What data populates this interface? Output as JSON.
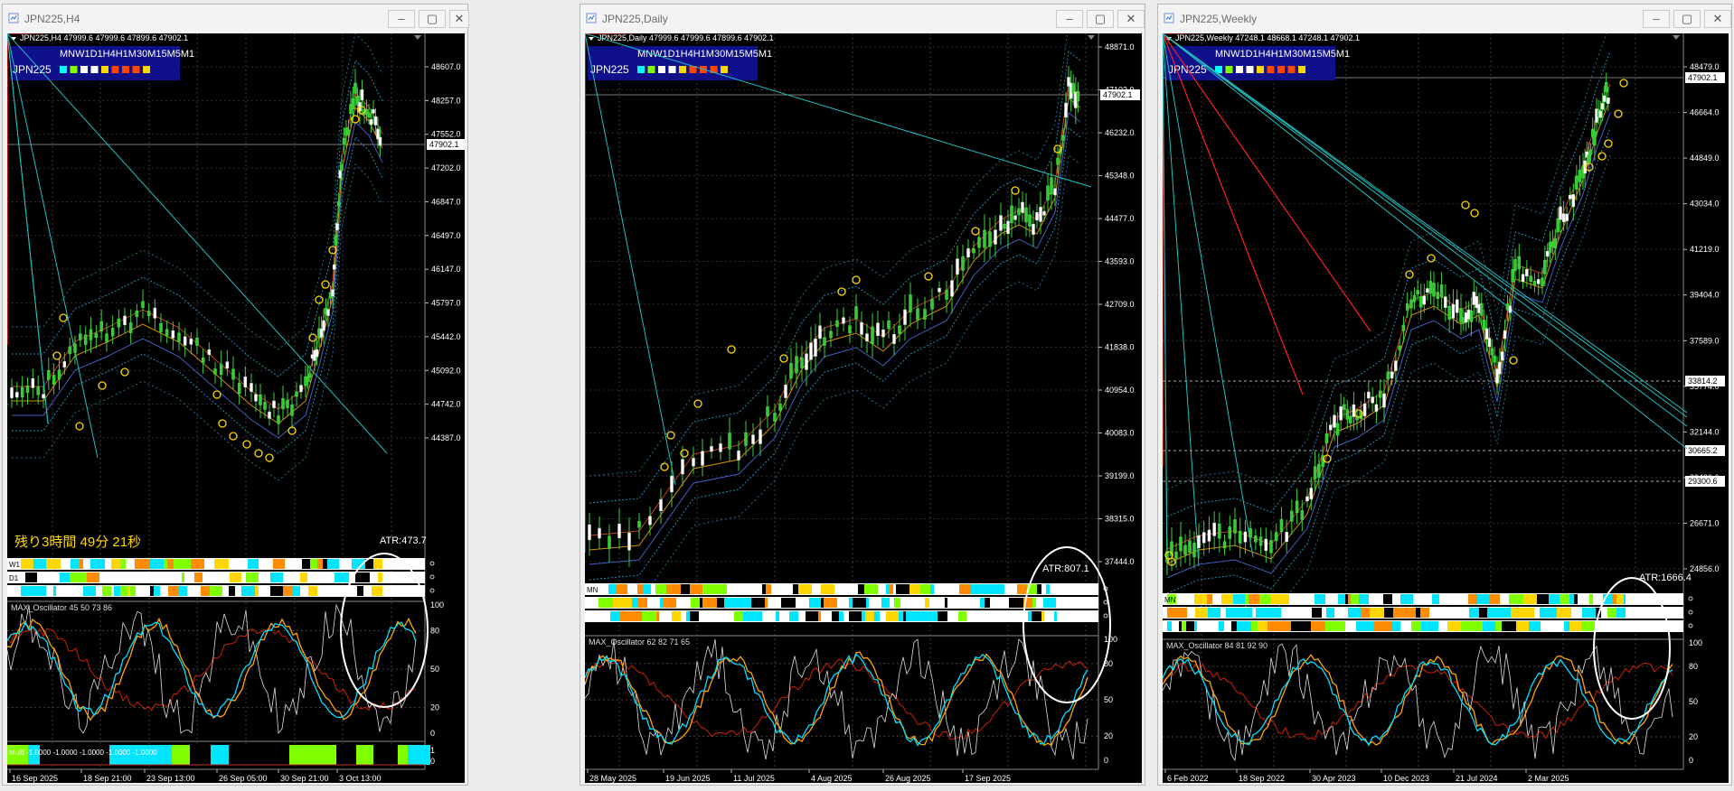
{
  "windows": [
    {
      "title": "JPN225,H4",
      "info": "JPN225,H4  47999.6 47999.6 47899.6 47902.1",
      "current_price": "47902.1",
      "price_ticks": [
        "48607.0",
        "48257.0",
        "47552.0",
        "47202.0",
        "46847.0",
        "46497.0",
        "46147.0",
        "45797.0",
        "45442.0",
        "45092.0",
        "44742.0",
        "44387.0"
      ],
      "atr": "ATR:473.7",
      "countdown": "残り3時間 49分 21秒",
      "strength_rows": [
        "W1",
        "D1",
        ""
      ],
      "oscillator_label": "MAX_Oscillator 45 50 73 86",
      "osc_ticks": [
        "100",
        "80",
        "50",
        "20",
        "0"
      ],
      "multi_label": "Multi -1.0000 -1.0000 -1.0000 -1.0000 -1.0000",
      "multi_ticks": [
        "1",
        "0"
      ],
      "date_ticks": [
        "16 Sep 2025",
        "18 Sep 21:00",
        "23 Sep 13:00",
        "26 Sep 05:00",
        "30 Sep 21:00",
        "3 Oct 13:00"
      ]
    },
    {
      "title": "JPN225,Daily",
      "info": "JPN225,Daily  47999.6 47999.6 47899.6 47902.1",
      "current_price": "47902.1",
      "price_ticks": [
        "48871.0",
        "47103.0",
        "46232.0",
        "45348.0",
        "44477.0",
        "43593.0",
        "42709.0",
        "41838.0",
        "40954.0",
        "40083.0",
        "39199.0",
        "38315.0",
        "37444.0"
      ],
      "atr": "ATR:807.1",
      "strength_rows": [
        "MN",
        "",
        ""
      ],
      "oscillator_label": "MAX_Oscillator 62 82 71 65",
      "osc_ticks": [
        "100",
        "80",
        "50",
        "20",
        "0"
      ],
      "date_ticks": [
        "28 May 2025",
        "19 Jun 2025",
        "11 Jul 2025",
        "4 Aug 2025",
        "26 Aug 2025",
        "17 Sep 2025"
      ]
    },
    {
      "title": "JPN225,Weekly",
      "info": "JPN225,Weekly  47248.1 48668.1 47248.1 47902.1",
      "current_price": "47902.1",
      "price_ticks": [
        "48479.0",
        "46664.0",
        "44849.0",
        "43034.0",
        "41219.0",
        "39404.0",
        "37589.0",
        "35774.0",
        "32144.0",
        "28486.0",
        "26671.0",
        "24856.0"
      ],
      "price_levels": [
        "33814.2",
        "30665.2",
        "29300.6"
      ],
      "atr": "ATR:1666.4",
      "strength_rows": [
        "MN",
        "",
        ""
      ],
      "oscillator_label": "MAX_Oscillator 84 81 92 90",
      "osc_ticks": [
        "100",
        "80",
        "50",
        "20",
        "0"
      ],
      "date_ticks": [
        "6 Feb 2022",
        "18 Sep 2022",
        "30 Apr 2023",
        "10 Dec 2023",
        "21 Jul 2024",
        "2 Mar 2025"
      ]
    }
  ],
  "panel": {
    "tf_labels": "MNW1D1H4H1M30M15M5M1",
    "symbol": "JPN225",
    "squares": [
      "#00ffff",
      "#7fff00",
      "#ffffff",
      "#ffffff",
      "#ffd700",
      "#ff4500",
      "#ff4500",
      "#ff4500",
      "#ffd700"
    ]
  },
  "buttons": {
    "minimize": "–",
    "restore": "▢",
    "close": "✕"
  },
  "colors": {
    "bull_candle": "#33cc33",
    "bear_candle": "#ffffff",
    "trendline": "#ff2020",
    "support_line": "#20c0c0",
    "circle": "#ffd700",
    "osc_cyan": "#00e0ff",
    "osc_orange": "#ffa500",
    "osc_red": "#cc2200",
    "osc_white": "#dddddd"
  }
}
